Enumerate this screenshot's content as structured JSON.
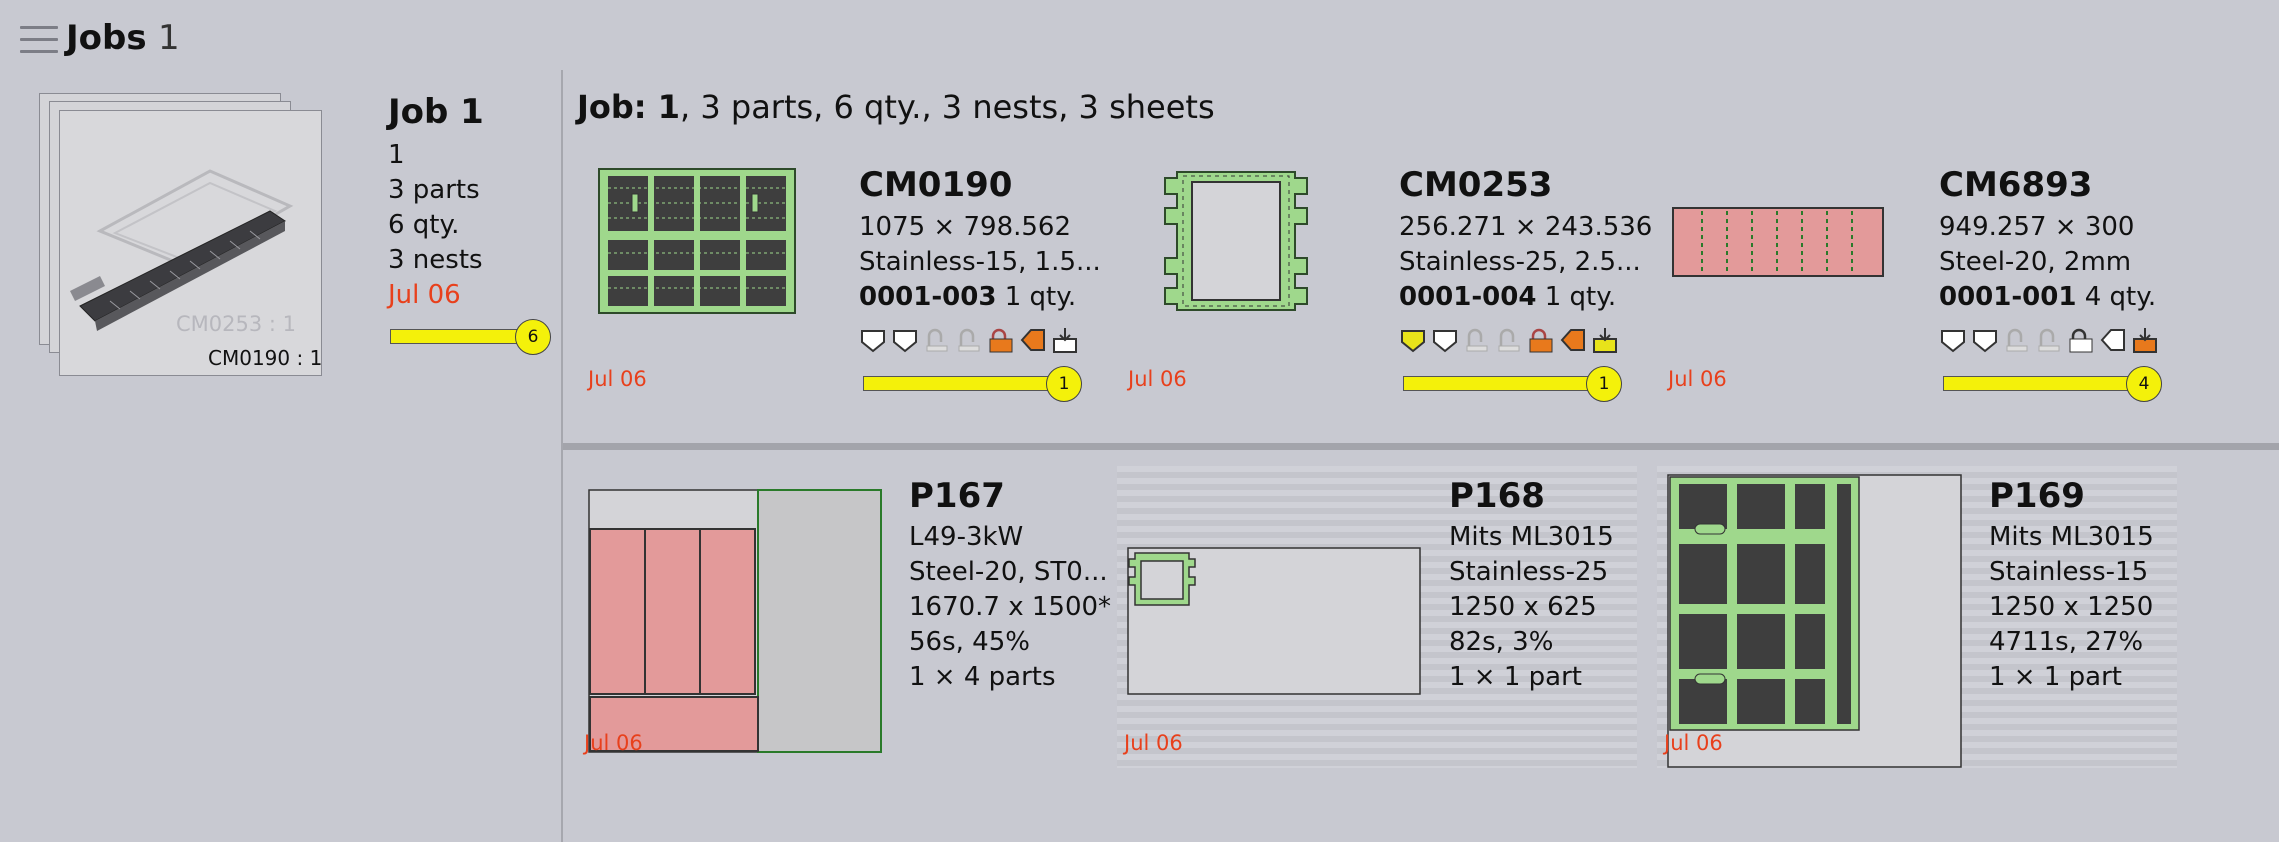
{
  "header": {
    "title": "Jobs",
    "count": "1"
  },
  "stack": {
    "ghost_label": "CM0253 : 1",
    "front_label": "CM0190 : 1"
  },
  "job": {
    "title": "Job 1",
    "lines": [
      "1",
      "3 parts",
      "6 qty.",
      "3 nests"
    ],
    "date": "Jul 06",
    "badge": "6"
  },
  "job_header": {
    "prefix": "Job: ",
    "number": "1",
    "rest": ", 3 parts, 6 qty., 3 nests, 3 sheets"
  },
  "parts": [
    {
      "name": "CM0190",
      "dims": "1075 × 798.562",
      "material": "Stainless-15, 1.5...",
      "code": "0001-003",
      "qty": " 1 qty.",
      "date": "Jul 06",
      "badge": "1"
    },
    {
      "name": "CM0253",
      "dims": "256.271 × 243.536",
      "material": "Stainless-25, 2.5...",
      "code": "0001-004",
      "qty": " 1 qty.",
      "date": "Jul 06",
      "badge": "1"
    },
    {
      "name": "CM6893",
      "dims": "949.257 × 300",
      "material": "Steel-20, 2mm",
      "code": "0001-001",
      "qty": " 4 qty.",
      "date": "Jul 06",
      "badge": "4"
    }
  ],
  "nests": [
    {
      "name": "P167",
      "machine": "L49-3kW",
      "material": "Steel-20, ST0...",
      "size": "1670.7 x 1500*",
      "stats": "56s, 45%",
      "parts": "1 × 4 parts",
      "date": "Jul 06"
    },
    {
      "name": "P168",
      "machine": "Mits ML3015",
      "material": "Stainless-25",
      "size": "1250 x 625",
      "stats": "82s, 3%",
      "parts": "1 × 1 part",
      "date": "Jul 06"
    },
    {
      "name": "P169",
      "machine": "Mits ML3015",
      "material": "Stainless-15",
      "size": "1250 x 1250",
      "stats": "4711s, 27%",
      "parts": "1 × 1 part",
      "date": "Jul 06"
    }
  ],
  "colors": {
    "accent_date": "#e8401c",
    "progress": "#f4f10a",
    "part_green": "#9fd88c",
    "part_red": "#e39a9a",
    "icon_orange": "#e8791c"
  }
}
